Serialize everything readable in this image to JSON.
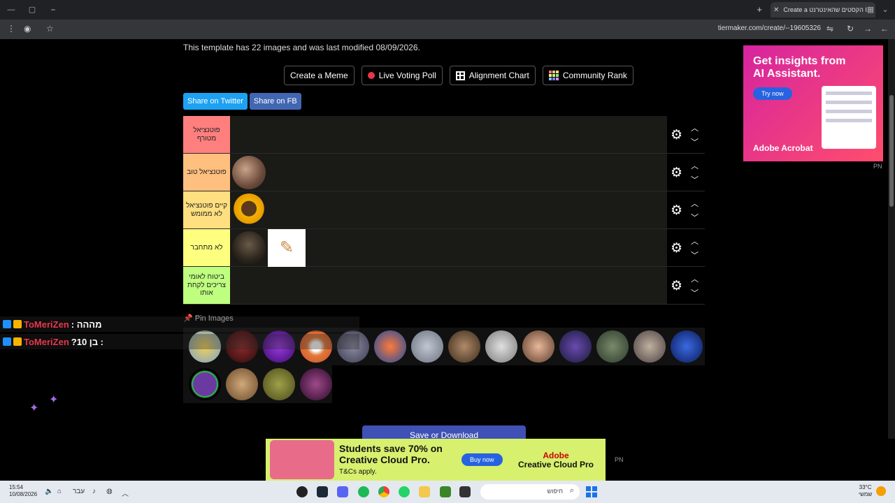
{
  "browser": {
    "tab_title": "Create a הקסטים שהאינטרנט I",
    "url": "tiermaker.com/create/--19605326"
  },
  "template_info": "This template has 22 images and was last modified 08/09/2026.",
  "toolbar": {
    "create_meme": "Create a Meme",
    "live_poll": "Live Voting Poll",
    "alignment": "Alignment Chart",
    "community": "Community Rank"
  },
  "share": {
    "twitter": "Share on Twitter",
    "fb": "Share on FB"
  },
  "tiers": [
    {
      "label": "פוטנציאל מטורף",
      "color": "#ff7f7f"
    },
    {
      "label": "פוטנציאל טוב",
      "color": "#ffbf7f"
    },
    {
      "label": "קיים פוטנציאל לא ממומש",
      "color": "#ffdf7f"
    },
    {
      "label": "לא מתחבר",
      "color": "#ffff7f"
    },
    {
      "label": "ביטוח לאומי צריכים לקחת אותו",
      "color": "#bfff7f"
    }
  ],
  "pin_label": "Pin Images",
  "save_button": "Save or Download",
  "ad_side": {
    "headline": "Get insights from AI Assistant.",
    "cta": "Try now",
    "brand": "Adobe Acrobat",
    "tag": "PN"
  },
  "ad_bottom": {
    "headline": "Students save 70% on Creative Cloud Pro.",
    "terms": "T&Cs apply.",
    "cta": "Buy now",
    "brand_top": "Adobe",
    "brand_bottom": "Creative Cloud Pro",
    "tag": "PN"
  },
  "chat": [
    {
      "user": "ToMeriZen",
      "message": ": מההה"
    },
    {
      "user": "ToMeriZen",
      "message": "?בן 10 :"
    }
  ],
  "taskbar": {
    "time": "15:54",
    "date": "10/08/2026",
    "search_placeholder": "חיפוש",
    "lang": "עבר",
    "temp": "33°C",
    "weather_text": "שמשי"
  },
  "colors": {
    "accent_blue": "#3f51b5",
    "twitter_blue": "#1da1f2",
    "fb_blue": "#4267b2",
    "chat_name": "#e8364c"
  }
}
